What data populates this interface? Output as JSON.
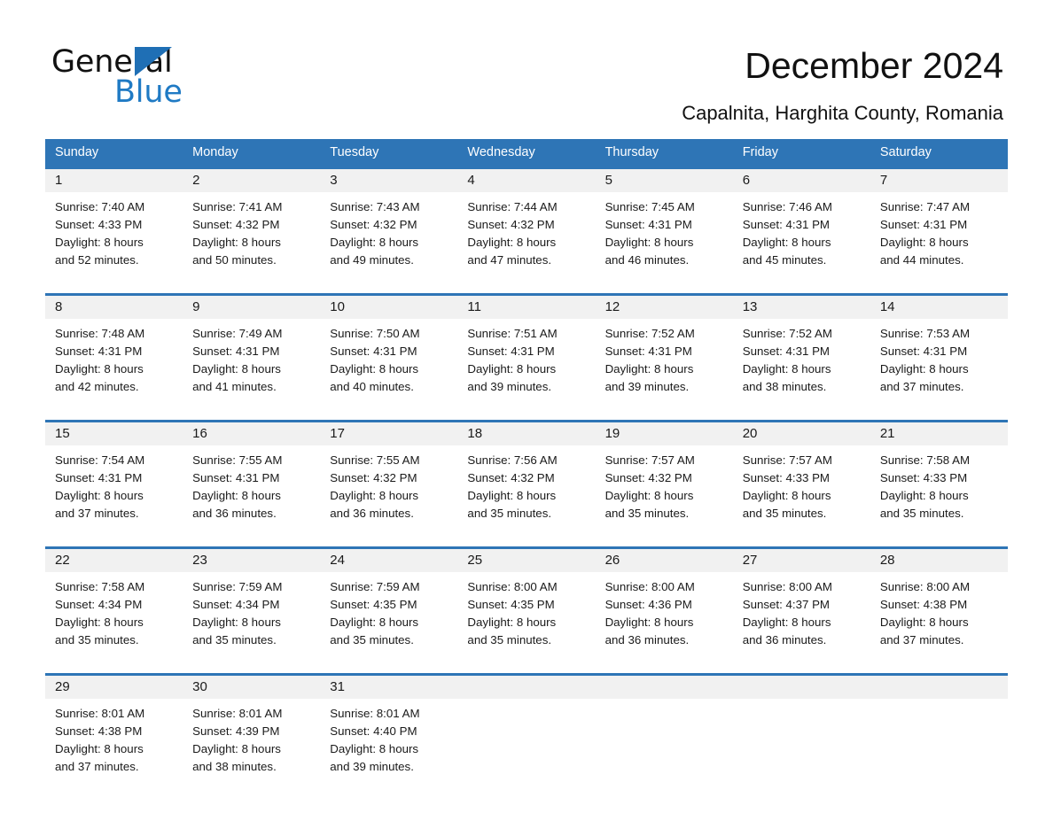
{
  "brand": {
    "name_part1": "General",
    "name_part2": "Blue",
    "accent_color": "#1f7ac4",
    "triangle_color": "#1f6fb5"
  },
  "header": {
    "title": "December 2024",
    "location": "Capalnita, Harghita County, Romania",
    "header_bg_color": "#2e75b6",
    "daynum_bg_color": "#f1f1f1"
  },
  "weekdays": [
    "Sunday",
    "Monday",
    "Tuesday",
    "Wednesday",
    "Thursday",
    "Friday",
    "Saturday"
  ],
  "weeks": [
    [
      {
        "day": "1",
        "sunrise": "Sunrise: 7:40 AM",
        "sunset": "Sunset: 4:33 PM",
        "daylight1": "Daylight: 8 hours",
        "daylight2": "and 52 minutes."
      },
      {
        "day": "2",
        "sunrise": "Sunrise: 7:41 AM",
        "sunset": "Sunset: 4:32 PM",
        "daylight1": "Daylight: 8 hours",
        "daylight2": "and 50 minutes."
      },
      {
        "day": "3",
        "sunrise": "Sunrise: 7:43 AM",
        "sunset": "Sunset: 4:32 PM",
        "daylight1": "Daylight: 8 hours",
        "daylight2": "and 49 minutes."
      },
      {
        "day": "4",
        "sunrise": "Sunrise: 7:44 AM",
        "sunset": "Sunset: 4:32 PM",
        "daylight1": "Daylight: 8 hours",
        "daylight2": "and 47 minutes."
      },
      {
        "day": "5",
        "sunrise": "Sunrise: 7:45 AM",
        "sunset": "Sunset: 4:31 PM",
        "daylight1": "Daylight: 8 hours",
        "daylight2": "and 46 minutes."
      },
      {
        "day": "6",
        "sunrise": "Sunrise: 7:46 AM",
        "sunset": "Sunset: 4:31 PM",
        "daylight1": "Daylight: 8 hours",
        "daylight2": "and 45 minutes."
      },
      {
        "day": "7",
        "sunrise": "Sunrise: 7:47 AM",
        "sunset": "Sunset: 4:31 PM",
        "daylight1": "Daylight: 8 hours",
        "daylight2": "and 44 minutes."
      }
    ],
    [
      {
        "day": "8",
        "sunrise": "Sunrise: 7:48 AM",
        "sunset": "Sunset: 4:31 PM",
        "daylight1": "Daylight: 8 hours",
        "daylight2": "and 42 minutes."
      },
      {
        "day": "9",
        "sunrise": "Sunrise: 7:49 AM",
        "sunset": "Sunset: 4:31 PM",
        "daylight1": "Daylight: 8 hours",
        "daylight2": "and 41 minutes."
      },
      {
        "day": "10",
        "sunrise": "Sunrise: 7:50 AM",
        "sunset": "Sunset: 4:31 PM",
        "daylight1": "Daylight: 8 hours",
        "daylight2": "and 40 minutes."
      },
      {
        "day": "11",
        "sunrise": "Sunrise: 7:51 AM",
        "sunset": "Sunset: 4:31 PM",
        "daylight1": "Daylight: 8 hours",
        "daylight2": "and 39 minutes."
      },
      {
        "day": "12",
        "sunrise": "Sunrise: 7:52 AM",
        "sunset": "Sunset: 4:31 PM",
        "daylight1": "Daylight: 8 hours",
        "daylight2": "and 39 minutes."
      },
      {
        "day": "13",
        "sunrise": "Sunrise: 7:52 AM",
        "sunset": "Sunset: 4:31 PM",
        "daylight1": "Daylight: 8 hours",
        "daylight2": "and 38 minutes."
      },
      {
        "day": "14",
        "sunrise": "Sunrise: 7:53 AM",
        "sunset": "Sunset: 4:31 PM",
        "daylight1": "Daylight: 8 hours",
        "daylight2": "and 37 minutes."
      }
    ],
    [
      {
        "day": "15",
        "sunrise": "Sunrise: 7:54 AM",
        "sunset": "Sunset: 4:31 PM",
        "daylight1": "Daylight: 8 hours",
        "daylight2": "and 37 minutes."
      },
      {
        "day": "16",
        "sunrise": "Sunrise: 7:55 AM",
        "sunset": "Sunset: 4:31 PM",
        "daylight1": "Daylight: 8 hours",
        "daylight2": "and 36 minutes."
      },
      {
        "day": "17",
        "sunrise": "Sunrise: 7:55 AM",
        "sunset": "Sunset: 4:32 PM",
        "daylight1": "Daylight: 8 hours",
        "daylight2": "and 36 minutes."
      },
      {
        "day": "18",
        "sunrise": "Sunrise: 7:56 AM",
        "sunset": "Sunset: 4:32 PM",
        "daylight1": "Daylight: 8 hours",
        "daylight2": "and 35 minutes."
      },
      {
        "day": "19",
        "sunrise": "Sunrise: 7:57 AM",
        "sunset": "Sunset: 4:32 PM",
        "daylight1": "Daylight: 8 hours",
        "daylight2": "and 35 minutes."
      },
      {
        "day": "20",
        "sunrise": "Sunrise: 7:57 AM",
        "sunset": "Sunset: 4:33 PM",
        "daylight1": "Daylight: 8 hours",
        "daylight2": "and 35 minutes."
      },
      {
        "day": "21",
        "sunrise": "Sunrise: 7:58 AM",
        "sunset": "Sunset: 4:33 PM",
        "daylight1": "Daylight: 8 hours",
        "daylight2": "and 35 minutes."
      }
    ],
    [
      {
        "day": "22",
        "sunrise": "Sunrise: 7:58 AM",
        "sunset": "Sunset: 4:34 PM",
        "daylight1": "Daylight: 8 hours",
        "daylight2": "and 35 minutes."
      },
      {
        "day": "23",
        "sunrise": "Sunrise: 7:59 AM",
        "sunset": "Sunset: 4:34 PM",
        "daylight1": "Daylight: 8 hours",
        "daylight2": "and 35 minutes."
      },
      {
        "day": "24",
        "sunrise": "Sunrise: 7:59 AM",
        "sunset": "Sunset: 4:35 PM",
        "daylight1": "Daylight: 8 hours",
        "daylight2": "and 35 minutes."
      },
      {
        "day": "25",
        "sunrise": "Sunrise: 8:00 AM",
        "sunset": "Sunset: 4:35 PM",
        "daylight1": "Daylight: 8 hours",
        "daylight2": "and 35 minutes."
      },
      {
        "day": "26",
        "sunrise": "Sunrise: 8:00 AM",
        "sunset": "Sunset: 4:36 PM",
        "daylight1": "Daylight: 8 hours",
        "daylight2": "and 36 minutes."
      },
      {
        "day": "27",
        "sunrise": "Sunrise: 8:00 AM",
        "sunset": "Sunset: 4:37 PM",
        "daylight1": "Daylight: 8 hours",
        "daylight2": "and 36 minutes."
      },
      {
        "day": "28",
        "sunrise": "Sunrise: 8:00 AM",
        "sunset": "Sunset: 4:38 PM",
        "daylight1": "Daylight: 8 hours",
        "daylight2": "and 37 minutes."
      }
    ],
    [
      {
        "day": "29",
        "sunrise": "Sunrise: 8:01 AM",
        "sunset": "Sunset: 4:38 PM",
        "daylight1": "Daylight: 8 hours",
        "daylight2": "and 37 minutes."
      },
      {
        "day": "30",
        "sunrise": "Sunrise: 8:01 AM",
        "sunset": "Sunset: 4:39 PM",
        "daylight1": "Daylight: 8 hours",
        "daylight2": "and 38 minutes."
      },
      {
        "day": "31",
        "sunrise": "Sunrise: 8:01 AM",
        "sunset": "Sunset: 4:40 PM",
        "daylight1": "Daylight: 8 hours",
        "daylight2": "and 39 minutes."
      },
      {
        "day": "",
        "sunrise": "",
        "sunset": "",
        "daylight1": "",
        "daylight2": ""
      },
      {
        "day": "",
        "sunrise": "",
        "sunset": "",
        "daylight1": "",
        "daylight2": ""
      },
      {
        "day": "",
        "sunrise": "",
        "sunset": "",
        "daylight1": "",
        "daylight2": ""
      },
      {
        "day": "",
        "sunrise": "",
        "sunset": "",
        "daylight1": "",
        "daylight2": ""
      }
    ]
  ]
}
